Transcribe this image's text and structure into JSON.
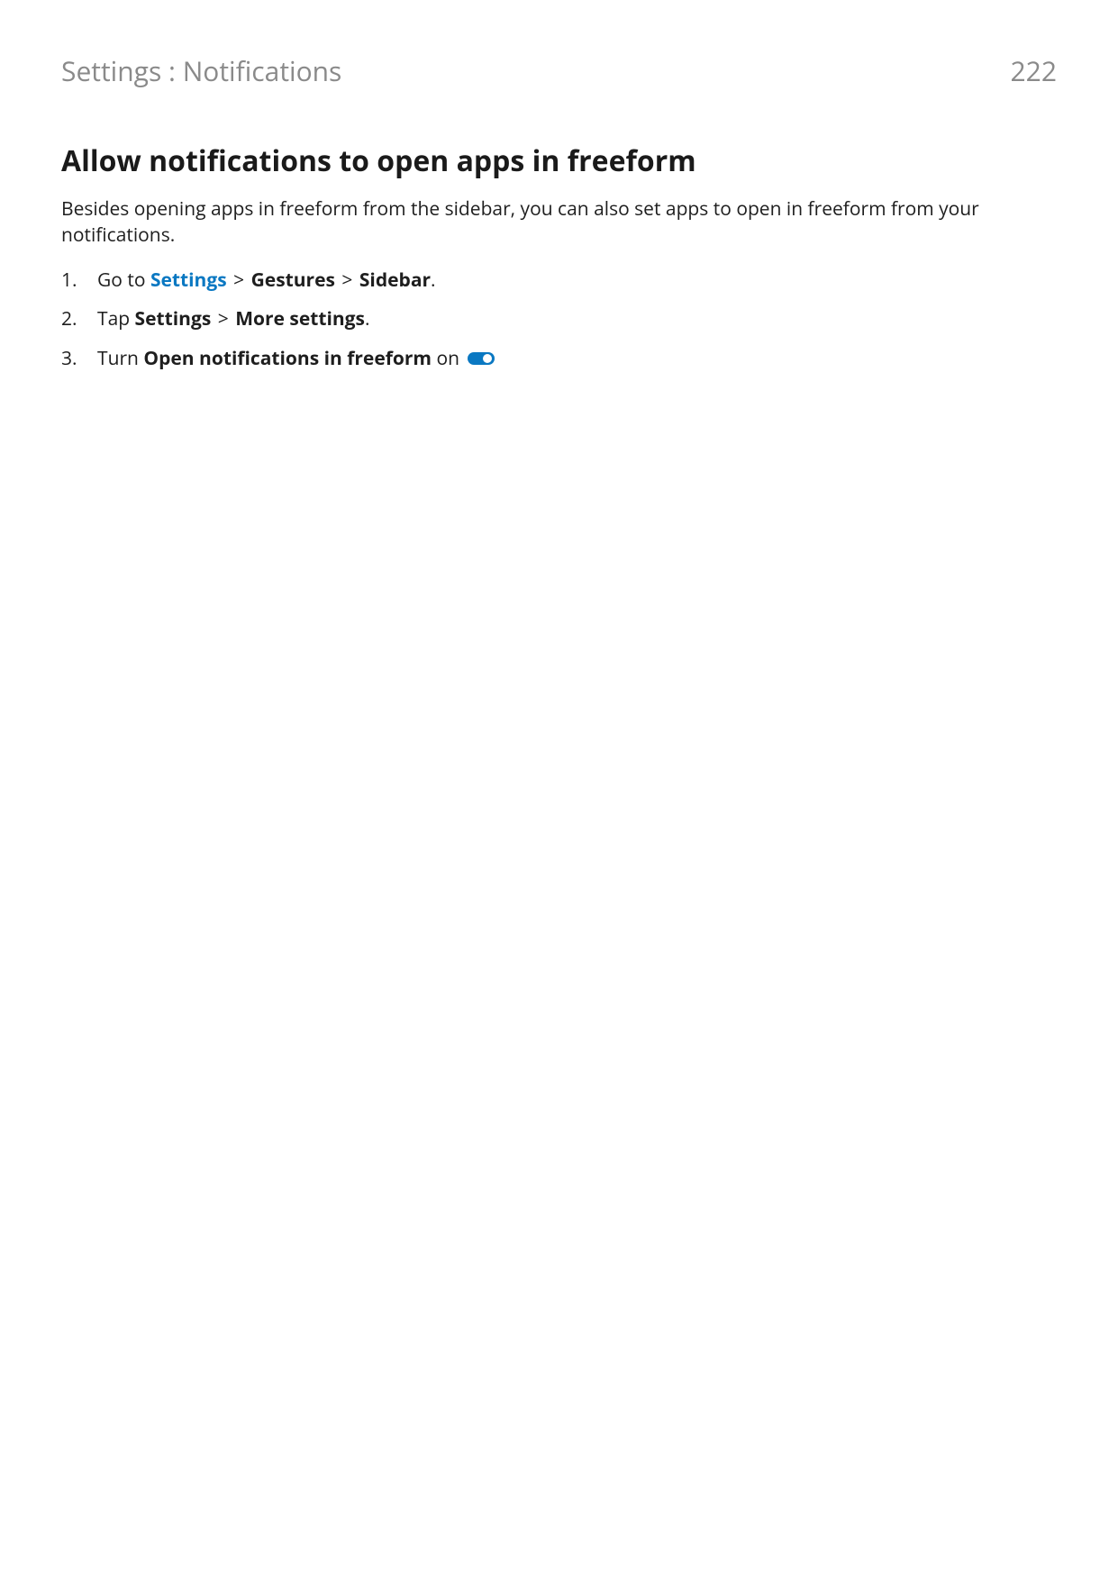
{
  "header": {
    "breadcrumb": "Settings : Notifications",
    "page_number": "222"
  },
  "main": {
    "heading": "Allow notifications to open apps in freeform",
    "intro": "Besides opening apps in freeform from the sidebar, you can also set apps to open in freeform from your notifications.",
    "steps": {
      "s1": {
        "prefix": "Go to ",
        "link": "Settings",
        "sep1": " > ",
        "b1": "Gestures",
        "sep2": " > ",
        "b2": "Sidebar",
        "suffix": "."
      },
      "s2": {
        "prefix": "Tap ",
        "b1": "Settings",
        "sep1": " > ",
        "b2": "More settings",
        "suffix": "."
      },
      "s3": {
        "prefix": "Turn ",
        "b1": "Open notifications in freeform",
        "mid": " on "
      }
    }
  }
}
